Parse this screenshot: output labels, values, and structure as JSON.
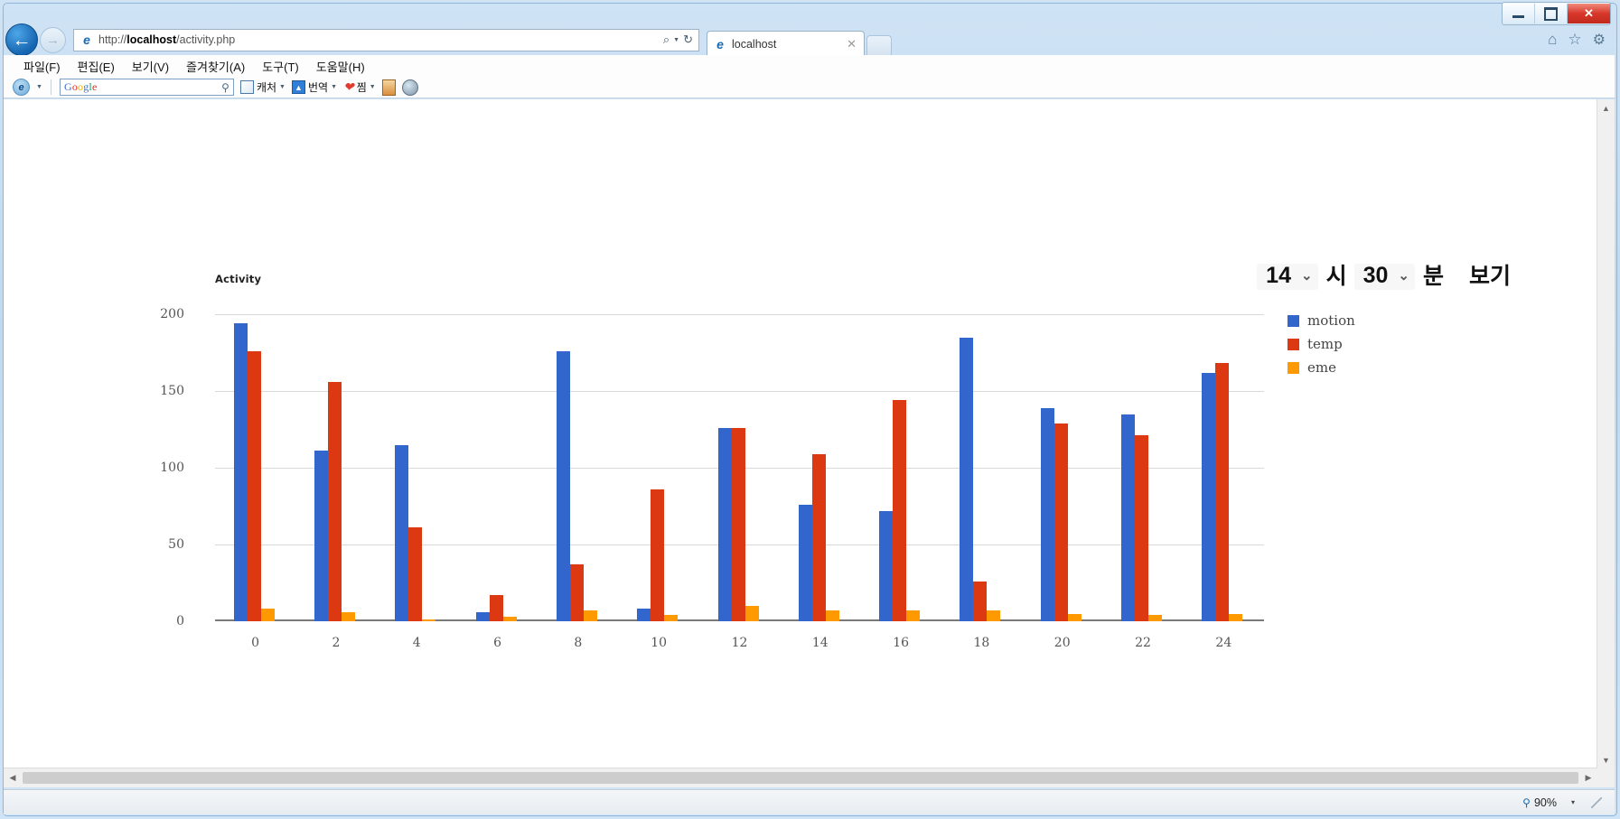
{
  "browser": {
    "window_buttons": {
      "minimize": "–",
      "maximize": "□",
      "close": "✕"
    },
    "back_icon": "←",
    "forward_icon": "→",
    "url": "http://localhost/activity.php",
    "url_host": "localhost",
    "url_prefix": "http://",
    "url_suffix": "/activity.php",
    "search_icon": "⌕",
    "refresh_icon": "↻",
    "tab_title": "localhost",
    "tab_close": "✕",
    "nav_right_icons": [
      "home-icon",
      "favorites-icon",
      "tools-icon"
    ],
    "home_icon": "⌂",
    "favorites_icon": "☆",
    "tools_icon": "⚙",
    "menu": [
      {
        "label": "파일(F)"
      },
      {
        "label": "편집(E)"
      },
      {
        "label": "보기(V)"
      },
      {
        "label": "즐겨찾기(A)"
      },
      {
        "label": "도구(T)"
      },
      {
        "label": "도움말(H)"
      }
    ],
    "google_toolbar": {
      "logo_letters": [
        "G",
        "o",
        "o",
        "g",
        "l",
        "e"
      ],
      "search_value": "",
      "search_placeholder": "",
      "items": [
        {
          "label": "캐처",
          "icon": "capture-icon",
          "caret": "▾"
        },
        {
          "label": "번역",
          "icon": "translate-icon",
          "caret": "▾"
        },
        {
          "label": "찜",
          "icon": "heart-icon",
          "caret": "▾"
        }
      ]
    },
    "statusbar": {
      "zoom_level": "90%",
      "zoom_caret": "▾"
    },
    "scroll": {
      "up": "▲",
      "down": "▼",
      "left": "◀",
      "right": "▶"
    }
  },
  "controls": {
    "hour_value": "14",
    "hour_unit": "시",
    "minute_value": "30",
    "minute_unit": "분",
    "view_button": "보기",
    "chevron": "⌄"
  },
  "chart_data": {
    "type": "bar",
    "title": "Activity",
    "xlabel": "",
    "ylabel": "",
    "ylim": [
      0,
      200
    ],
    "yticks": [
      0,
      50,
      100,
      150,
      200
    ],
    "ytick_labels": [
      "0",
      "50",
      "100",
      "150",
      "200"
    ],
    "categories": [
      "0",
      "2",
      "4",
      "6",
      "8",
      "10",
      "12",
      "14",
      "16",
      "18",
      "20",
      "22",
      "24"
    ],
    "grid": true,
    "legend_position": "right",
    "colors": {
      "motion": "#3366cc",
      "temp": "#dc3912",
      "eme": "#ff9900"
    },
    "series": [
      {
        "name": "motion",
        "color": "#3366cc",
        "values": [
          194,
          111,
          115,
          6,
          176,
          8,
          126,
          76,
          72,
          185,
          139,
          135,
          162
        ]
      },
      {
        "name": "temp",
        "color": "#dc3912",
        "values": [
          176,
          156,
          61,
          17,
          37,
          86,
          126,
          109,
          144,
          26,
          129,
          121,
          168
        ]
      },
      {
        "name": "eme",
        "color": "#ff9900",
        "values": [
          8,
          6,
          1,
          3,
          7,
          4,
          10,
          7,
          7,
          7,
          5,
          4,
          5
        ]
      }
    ]
  }
}
